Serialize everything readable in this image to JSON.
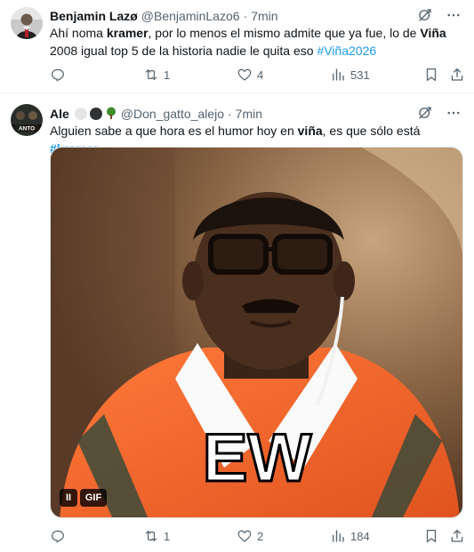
{
  "tweets": [
    {
      "name": "Benjamin Lazø",
      "handle": "@BenjaminLazo6",
      "separator": "·",
      "time": "7min",
      "text": {
        "p1": "Ahí noma ",
        "b1": "kramer",
        "p2": ", por lo menos el mismo admite que ya fue, lo de ",
        "b2": "Viña",
        "p3": " 2008 igual top 5 de la historia nadie le quita eso ",
        "hashtag": "#Viña2026"
      },
      "stats": {
        "replies": "",
        "retweets": "1",
        "likes": "4",
        "views": "531"
      }
    },
    {
      "name": "Ale",
      "handle": "@Don_gatto_alejo",
      "separator": "·",
      "time": "7min",
      "avatar_text": "ANTO",
      "text": {
        "p1": "Alguien sabe a que hora es el humor hoy en ",
        "b1": "viña",
        "p2": ", es que sólo está ",
        "hashtag": "#kramer"
      },
      "media": {
        "caption": "EW",
        "gif_label": "GIF",
        "pause_label": "II"
      },
      "stats": {
        "replies": "",
        "retweets": "1",
        "likes": "2",
        "views": "184"
      }
    }
  ],
  "colors": {
    "accent": "#1d9bf0",
    "text_primary": "#0f1419",
    "text_secondary": "#536471",
    "divider": "#eff3f4"
  },
  "icons": {
    "grok": "grok-icon",
    "more": "more-icon",
    "reply": "reply-icon",
    "retweet": "retweet-icon",
    "like": "heart-icon",
    "views": "views-icon",
    "bookmark": "bookmark-icon",
    "share": "share-icon"
  }
}
